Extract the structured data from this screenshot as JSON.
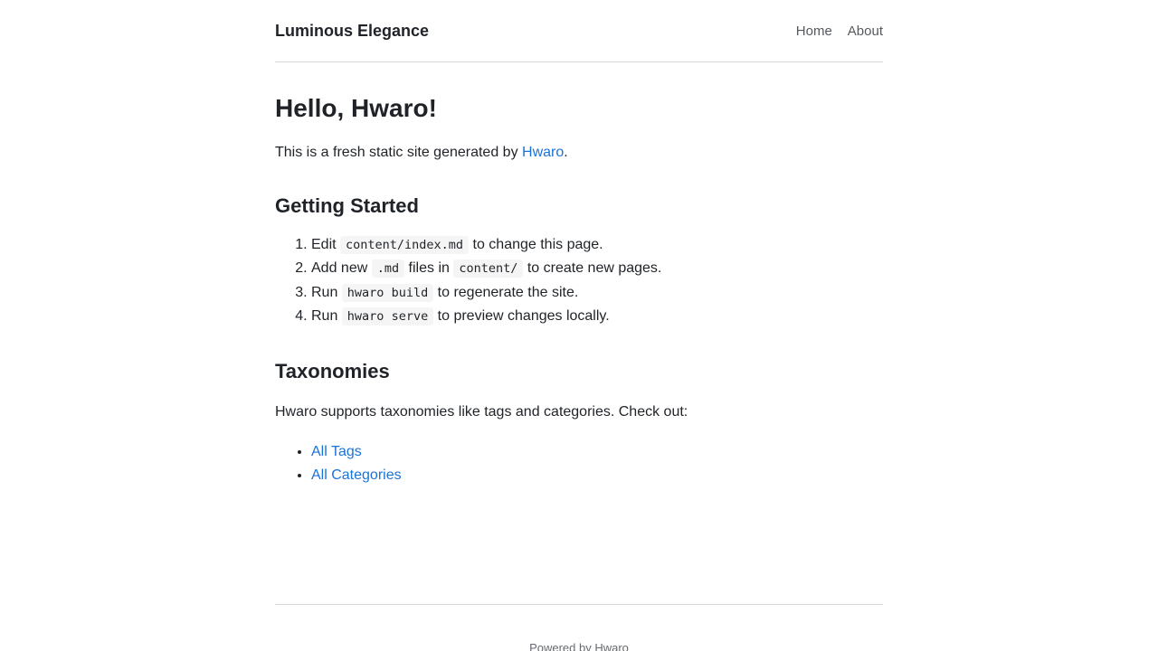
{
  "header": {
    "site_title": "Luminous Elegance",
    "nav": [
      "Home",
      "About"
    ]
  },
  "main": {
    "title": "Hello, Hwaro!",
    "intro_prefix": "This is a fresh static site generated by ",
    "intro_link": "Hwaro",
    "intro_suffix": ".",
    "getting_started": {
      "heading": "Getting Started",
      "steps": [
        {
          "pre": "Edit ",
          "code": "content/index.md",
          "post": " to change this page."
        },
        {
          "pre": "Add new ",
          "code": ".md",
          "mid": " files in ",
          "code2": "content/",
          "post": " to create new pages."
        },
        {
          "pre": "Run ",
          "code": "hwaro build",
          "post": " to regenerate the site."
        },
        {
          "pre": "Run ",
          "code": "hwaro serve",
          "post": " to preview changes locally."
        }
      ]
    },
    "taxonomies": {
      "heading": "Taxonomies",
      "text": "Hwaro supports taxonomies like tags and categories. Check out:",
      "links": [
        "All Tags",
        "All Categories"
      ]
    }
  },
  "footer": {
    "prefix": "Powered by ",
    "link": "Hwaro"
  },
  "colors": {
    "link": "#1a73d9",
    "text": "#1f2328",
    "nav": "#555a60",
    "divider": "#d9d9d9"
  }
}
